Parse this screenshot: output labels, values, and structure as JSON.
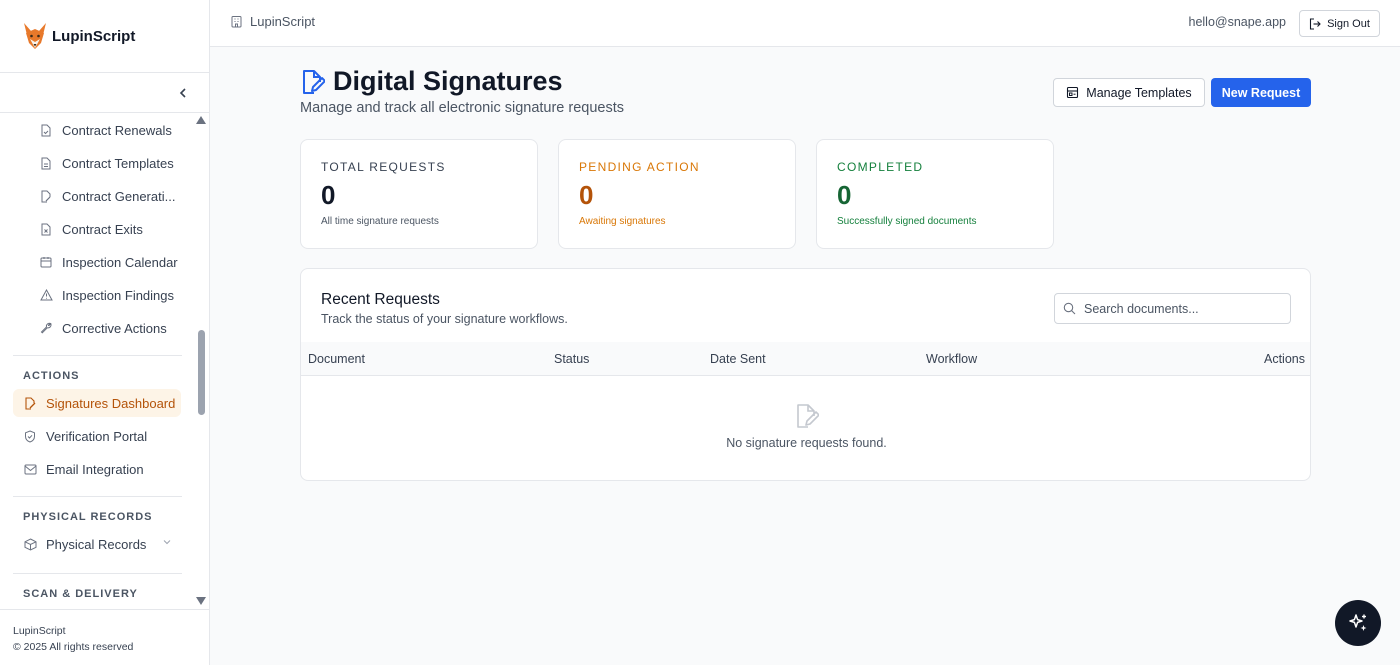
{
  "brand": {
    "name": "LupinScript"
  },
  "sidebar": {
    "items_contracts": [
      {
        "label": "Contract Renewals",
        "icon": "file-check-icon"
      },
      {
        "label": "Contract Templates",
        "icon": "file-text-icon"
      },
      {
        "label": "Contract Generati...",
        "icon": "file-pen-icon"
      },
      {
        "label": "Contract Exits",
        "icon": "file-x-icon"
      },
      {
        "label": "Inspection Calendar",
        "icon": "calendar-icon"
      },
      {
        "label": "Inspection Findings",
        "icon": "alert-triangle-icon"
      },
      {
        "label": "Corrective Actions",
        "icon": "wrench-icon"
      }
    ],
    "section_actions": "ACTIONS",
    "actions": [
      {
        "label": "Signatures Dashboard",
        "icon": "signature-icon",
        "active": true
      },
      {
        "label": "Verification Portal",
        "icon": "shield-check-icon"
      },
      {
        "label": "Email Integration",
        "icon": "mail-icon"
      }
    ],
    "section_physical": "PHYSICAL RECORDS",
    "physical": [
      {
        "label": "Physical Records",
        "icon": "box-icon"
      }
    ],
    "section_scan": "SCAN & DELIVERY",
    "footer_name": "LupinScript",
    "footer_copy": "© 2025 All rights reserved"
  },
  "topbar": {
    "org_name": "LupinScript",
    "email": "hello@snape.app",
    "signout_label": "Sign Out"
  },
  "page": {
    "title": "Digital Signatures",
    "subtitle": "Manage and track all electronic signature requests",
    "manage_templates_label": "Manage Templates",
    "new_request_label": "New Request"
  },
  "stats": [
    {
      "label": "TOTAL REQUESTS",
      "value": "0",
      "desc": "All time signature requests",
      "color": "#374151",
      "value_color": "#111827"
    },
    {
      "label": "PENDING ACTION",
      "value": "0",
      "desc": "Awaiting signatures",
      "color": "#d97706",
      "value_color": "#b45309"
    },
    {
      "label": "COMPLETED",
      "value": "0",
      "desc": "Successfully signed documents",
      "color": "#15803d",
      "value_color": "#166534"
    }
  ],
  "recent": {
    "title": "Recent Requests",
    "subtitle": "Track the status of your signature workflows.",
    "search_placeholder": "Search documents...",
    "columns": [
      "Document",
      "Status",
      "Date Sent",
      "Workflow",
      "Actions"
    ],
    "empty_text": "No signature requests found."
  },
  "colors": {
    "accent": "#2563eb",
    "active_nav": "#b45309"
  }
}
